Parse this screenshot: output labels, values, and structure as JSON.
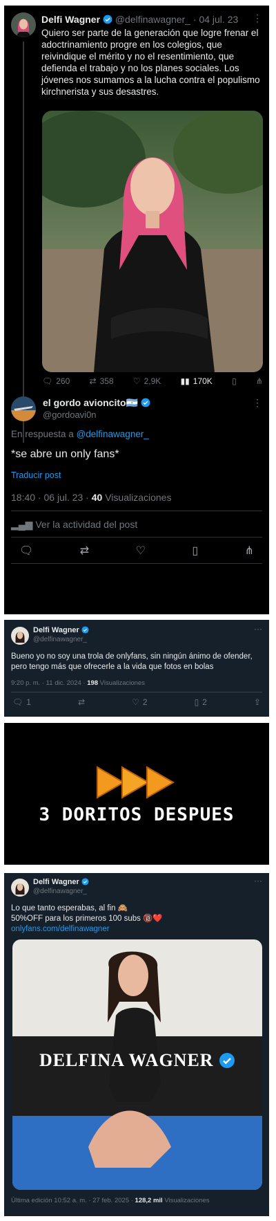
{
  "tweet1": {
    "name": "Delfi Wagner",
    "handle": "@delfinawagner_",
    "date": "· 04 jul. 23",
    "text": "Quiero ser parte de la generación que logre frenar el adoctrinamiento progre en los colegios, que reivindique el mérito y no el resentimiento, que defienda el trabajo y no los planes sociales. Los jóvenes nos sumamos a la lucha contra el populismo kirchnerista y sus desastres.",
    "stats": {
      "replies": "260",
      "reposts": "358",
      "likes": "2,9K",
      "views": "170K"
    }
  },
  "reply": {
    "name": "el gordo avioncito",
    "flag": "🇦🇷",
    "handle": "@gordoavi0n",
    "in_reply_prefix": "En respuesta a ",
    "in_reply_handle": "@delfinawagner_",
    "text": "*se abre un only fans*",
    "translate": "Traducir post",
    "time": "18:40 · 06 jul. 23 · ",
    "views_count": "40",
    "views_label": " Visualizaciones",
    "activity": "Ver la actividad del post"
  },
  "tweet2": {
    "name": "Delfi Wagner",
    "handle": "@delfinawagner_",
    "text": "Bueno yo no soy una trola de onlyfans, sin ningún ánimo de ofender, pero tengo más que ofrecerle a la vida que fotos en bolas",
    "time": "9:20 p. m. · 11 dic. 2024 · ",
    "views_count": "198",
    "views_label": " Visualizaciones",
    "stats": {
      "replies": "1",
      "reposts": "",
      "likes": "2",
      "bookmarks": "2"
    }
  },
  "meme": {
    "caption": "3 DORITOS DESPUES"
  },
  "tweet3": {
    "name": "Delfi Wagner",
    "handle": "@delfinawagner_",
    "line1": "Lo que tanto esperabas, al fin 🙈",
    "line2": "50%OFF para los primeros 100 subs 🔞❤️",
    "link": "onlyfans.com/delfinawagner",
    "overlay_name": "DELFINA WAGNER",
    "meta_prefix": "Última edición 10:52 a. m. · 27 feb. 2025 · ",
    "views_count": "128,2 mil",
    "views_label": " Visualizaciones"
  },
  "colors": {
    "x_blue": "#1d9bf0",
    "dim_bg": "#15202b",
    "muted": "#71767b",
    "text": "#e7e9ea"
  }
}
